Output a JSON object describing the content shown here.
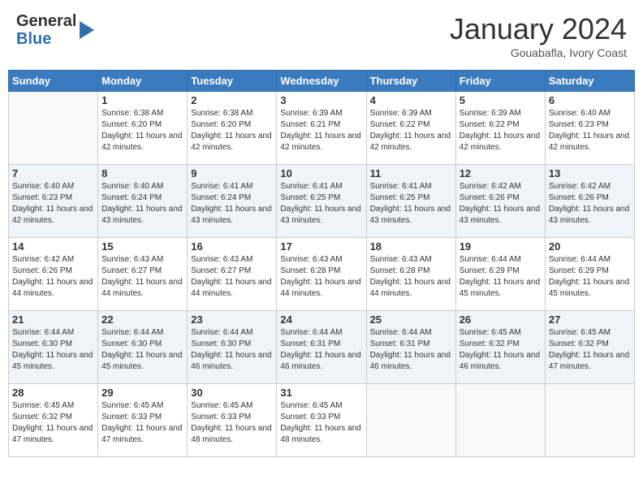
{
  "header": {
    "logo_line1": "General",
    "logo_line2": "Blue",
    "month": "January 2024",
    "location": "Gouabafla, Ivory Coast"
  },
  "days_of_week": [
    "Sunday",
    "Monday",
    "Tuesday",
    "Wednesday",
    "Thursday",
    "Friday",
    "Saturday"
  ],
  "weeks": [
    [
      {
        "day": "",
        "sunrise": "",
        "sunset": "",
        "daylight": ""
      },
      {
        "day": "1",
        "sunrise": "Sunrise: 6:38 AM",
        "sunset": "Sunset: 6:20 PM",
        "daylight": "Daylight: 11 hours and 42 minutes."
      },
      {
        "day": "2",
        "sunrise": "Sunrise: 6:38 AM",
        "sunset": "Sunset: 6:20 PM",
        "daylight": "Daylight: 11 hours and 42 minutes."
      },
      {
        "day": "3",
        "sunrise": "Sunrise: 6:39 AM",
        "sunset": "Sunset: 6:21 PM",
        "daylight": "Daylight: 11 hours and 42 minutes."
      },
      {
        "day": "4",
        "sunrise": "Sunrise: 6:39 AM",
        "sunset": "Sunset: 6:22 PM",
        "daylight": "Daylight: 11 hours and 42 minutes."
      },
      {
        "day": "5",
        "sunrise": "Sunrise: 6:39 AM",
        "sunset": "Sunset: 6:22 PM",
        "daylight": "Daylight: 11 hours and 42 minutes."
      },
      {
        "day": "6",
        "sunrise": "Sunrise: 6:40 AM",
        "sunset": "Sunset: 6:23 PM",
        "daylight": "Daylight: 11 hours and 42 minutes."
      }
    ],
    [
      {
        "day": "7",
        "sunrise": "Sunrise: 6:40 AM",
        "sunset": "Sunset: 6:23 PM",
        "daylight": "Daylight: 11 hours and 42 minutes."
      },
      {
        "day": "8",
        "sunrise": "Sunrise: 6:40 AM",
        "sunset": "Sunset: 6:24 PM",
        "daylight": "Daylight: 11 hours and 43 minutes."
      },
      {
        "day": "9",
        "sunrise": "Sunrise: 6:41 AM",
        "sunset": "Sunset: 6:24 PM",
        "daylight": "Daylight: 11 hours and 43 minutes."
      },
      {
        "day": "10",
        "sunrise": "Sunrise: 6:41 AM",
        "sunset": "Sunset: 6:25 PM",
        "daylight": "Daylight: 11 hours and 43 minutes."
      },
      {
        "day": "11",
        "sunrise": "Sunrise: 6:41 AM",
        "sunset": "Sunset: 6:25 PM",
        "daylight": "Daylight: 11 hours and 43 minutes."
      },
      {
        "day": "12",
        "sunrise": "Sunrise: 6:42 AM",
        "sunset": "Sunset: 6:26 PM",
        "daylight": "Daylight: 11 hours and 43 minutes."
      },
      {
        "day": "13",
        "sunrise": "Sunrise: 6:42 AM",
        "sunset": "Sunset: 6:26 PM",
        "daylight": "Daylight: 11 hours and 43 minutes."
      }
    ],
    [
      {
        "day": "14",
        "sunrise": "Sunrise: 6:42 AM",
        "sunset": "Sunset: 6:26 PM",
        "daylight": "Daylight: 11 hours and 44 minutes."
      },
      {
        "day": "15",
        "sunrise": "Sunrise: 6:43 AM",
        "sunset": "Sunset: 6:27 PM",
        "daylight": "Daylight: 11 hours and 44 minutes."
      },
      {
        "day": "16",
        "sunrise": "Sunrise: 6:43 AM",
        "sunset": "Sunset: 6:27 PM",
        "daylight": "Daylight: 11 hours and 44 minutes."
      },
      {
        "day": "17",
        "sunrise": "Sunrise: 6:43 AM",
        "sunset": "Sunset: 6:28 PM",
        "daylight": "Daylight: 11 hours and 44 minutes."
      },
      {
        "day": "18",
        "sunrise": "Sunrise: 6:43 AM",
        "sunset": "Sunset: 6:28 PM",
        "daylight": "Daylight: 11 hours and 44 minutes."
      },
      {
        "day": "19",
        "sunrise": "Sunrise: 6:44 AM",
        "sunset": "Sunset: 6:29 PM",
        "daylight": "Daylight: 11 hours and 45 minutes."
      },
      {
        "day": "20",
        "sunrise": "Sunrise: 6:44 AM",
        "sunset": "Sunset: 6:29 PM",
        "daylight": "Daylight: 11 hours and 45 minutes."
      }
    ],
    [
      {
        "day": "21",
        "sunrise": "Sunrise: 6:44 AM",
        "sunset": "Sunset: 6:30 PM",
        "daylight": "Daylight: 11 hours and 45 minutes."
      },
      {
        "day": "22",
        "sunrise": "Sunrise: 6:44 AM",
        "sunset": "Sunset: 6:30 PM",
        "daylight": "Daylight: 11 hours and 45 minutes."
      },
      {
        "day": "23",
        "sunrise": "Sunrise: 6:44 AM",
        "sunset": "Sunset: 6:30 PM",
        "daylight": "Daylight: 11 hours and 46 minutes."
      },
      {
        "day": "24",
        "sunrise": "Sunrise: 6:44 AM",
        "sunset": "Sunset: 6:31 PM",
        "daylight": "Daylight: 11 hours and 46 minutes."
      },
      {
        "day": "25",
        "sunrise": "Sunrise: 6:44 AM",
        "sunset": "Sunset: 6:31 PM",
        "daylight": "Daylight: 11 hours and 46 minutes."
      },
      {
        "day": "26",
        "sunrise": "Sunrise: 6:45 AM",
        "sunset": "Sunset: 6:32 PM",
        "daylight": "Daylight: 11 hours and 46 minutes."
      },
      {
        "day": "27",
        "sunrise": "Sunrise: 6:45 AM",
        "sunset": "Sunset: 6:32 PM",
        "daylight": "Daylight: 11 hours and 47 minutes."
      }
    ],
    [
      {
        "day": "28",
        "sunrise": "Sunrise: 6:45 AM",
        "sunset": "Sunset: 6:32 PM",
        "daylight": "Daylight: 11 hours and 47 minutes."
      },
      {
        "day": "29",
        "sunrise": "Sunrise: 6:45 AM",
        "sunset": "Sunset: 6:33 PM",
        "daylight": "Daylight: 11 hours and 47 minutes."
      },
      {
        "day": "30",
        "sunrise": "Sunrise: 6:45 AM",
        "sunset": "Sunset: 6:33 PM",
        "daylight": "Daylight: 11 hours and 48 minutes."
      },
      {
        "day": "31",
        "sunrise": "Sunrise: 6:45 AM",
        "sunset": "Sunset: 6:33 PM",
        "daylight": "Daylight: 11 hours and 48 minutes."
      },
      {
        "day": "",
        "sunrise": "",
        "sunset": "",
        "daylight": ""
      },
      {
        "day": "",
        "sunrise": "",
        "sunset": "",
        "daylight": ""
      },
      {
        "day": "",
        "sunrise": "",
        "sunset": "",
        "daylight": ""
      }
    ]
  ]
}
